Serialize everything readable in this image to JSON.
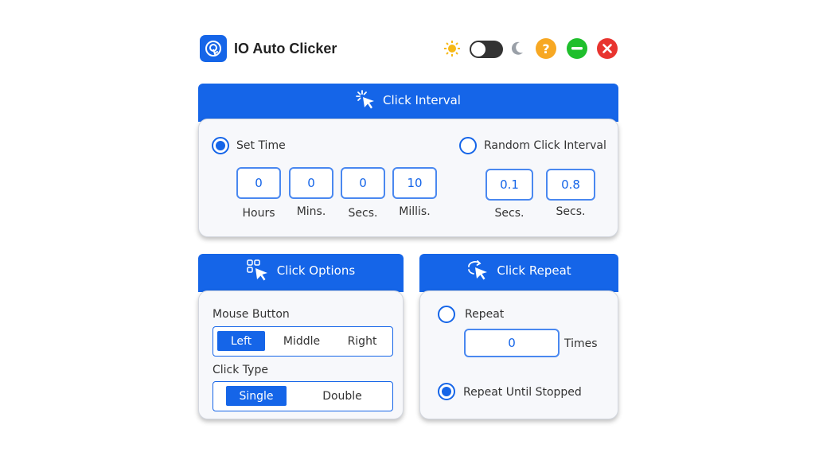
{
  "app": {
    "title": "IO Auto Clicker"
  },
  "header_controls": {
    "light_icon": "sun-icon",
    "dark_icon": "moon-icon",
    "help_label": "?",
    "minimize_color": "#1fbf2c",
    "close_color": "#e8342f",
    "help_color": "#f7a823"
  },
  "click_interval": {
    "title": "Click Interval",
    "set_time_label": "Set Time",
    "random_label": "Random Click Interval",
    "set_time_selected": true,
    "fields": [
      {
        "value": "0",
        "unit": "Hours"
      },
      {
        "value": "0",
        "unit": "Mins."
      },
      {
        "value": "0",
        "unit": "Secs."
      },
      {
        "value": "10",
        "unit": "Millis."
      }
    ],
    "random_fields": [
      {
        "value": "0.1",
        "unit": "Secs."
      },
      {
        "value": "0.8",
        "unit": "Secs."
      }
    ]
  },
  "click_options": {
    "title": "Click Options",
    "mouse_button_label": "Mouse Button",
    "mouse_buttons": [
      "Left",
      "Middle",
      "Right"
    ],
    "mouse_button_selected": "Left",
    "click_type_label": "Click Type",
    "click_types": [
      "Single",
      "Double"
    ],
    "click_type_selected": "Single"
  },
  "click_repeat": {
    "title": "Click Repeat",
    "repeat_label": "Repeat",
    "repeat_value": "0",
    "times_label": "Times",
    "until_stopped_label": "Repeat Until Stopped",
    "until_stopped_selected": true
  },
  "colors": {
    "accent": "#1565e8"
  }
}
